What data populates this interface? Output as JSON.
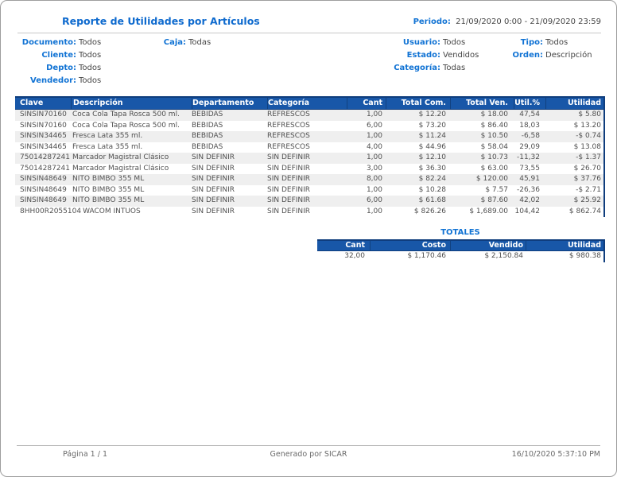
{
  "page": {
    "title": "Reporte de Utilidades por Artículos",
    "periodo": {
      "label": "Periodo:",
      "value": "21/09/2020 0:00  - 21/09/2020 23:59"
    }
  },
  "filters": {
    "documento": {
      "label": "Documento:",
      "value": "Todos"
    },
    "cliente": {
      "label": "Cliente:",
      "value": "Todos"
    },
    "depto": {
      "label": "Depto:",
      "value": "Todos"
    },
    "vendedor": {
      "label": "Vendedor:",
      "value": "Todos"
    },
    "caja": {
      "label": "Caja:",
      "value": "Todas"
    },
    "usuario": {
      "label": "Usuario:",
      "value": "Todos"
    },
    "estado": {
      "label": "Estado:",
      "value": "Vendidos"
    },
    "categoria": {
      "label": "Categoría:",
      "value": "Todas"
    },
    "tipo": {
      "label": "Tipo:",
      "value": "Todos"
    },
    "orden": {
      "label": "Orden:",
      "value": "Descripción"
    }
  },
  "table": {
    "columns": [
      "Clave",
      "Descripción",
      "Departamento",
      "Categoría",
      "Cant",
      "Total Com.",
      "Total Ven.",
      "Util.%",
      "Utilidad"
    ],
    "rows": [
      [
        "SINSIN70160",
        "Coca Cola Tapa Rosca 500 ml.",
        "BEBIDAS",
        "REFRESCOS",
        "1,00",
        "$ 12.20",
        "$ 18.00",
        "47,54",
        "$ 5.80"
      ],
      [
        "SINSIN70160",
        "Coca Cola Tapa Rosca 500 ml.",
        "BEBIDAS",
        "REFRESCOS",
        "6,00",
        "$ 73.20",
        "$ 86.40",
        "18,03",
        "$ 13.20"
      ],
      [
        "SINSIN34465",
        "Fresca Lata 355 ml.",
        "BEBIDAS",
        "REFRESCOS",
        "1,00",
        "$ 11.24",
        "$ 10.50",
        "-6,58",
        "-$ 0.74"
      ],
      [
        "SINSIN34465",
        "Fresca Lata 355 ml.",
        "BEBIDAS",
        "REFRESCOS",
        "4,00",
        "$ 44.96",
        "$ 58.04",
        "29,09",
        "$ 13.08"
      ],
      [
        "75014287241",
        "Marcador Magistral Clásico",
        "SIN DEFINIR",
        "SIN DEFINIR",
        "1,00",
        "$ 12.10",
        "$ 10.73",
        "-11,32",
        "-$ 1.37"
      ],
      [
        "75014287241",
        "Marcador Magistral Clásico",
        "SIN DEFINIR",
        "SIN DEFINIR",
        "3,00",
        "$ 36.30",
        "$ 63.00",
        "73,55",
        "$ 26.70"
      ],
      [
        "SINSIN48649",
        "NITO BIMBO 355 ML",
        "SIN DEFINIR",
        "SIN DEFINIR",
        "8,00",
        "$ 82.24",
        "$ 120.00",
        "45,91",
        "$ 37.76"
      ],
      [
        "SINSIN48649",
        "NITO BIMBO 355 ML",
        "SIN DEFINIR",
        "SIN DEFINIR",
        "1,00",
        "$ 10.28",
        "$ 7.57",
        "-26,36",
        "-$ 2.71"
      ],
      [
        "SINSIN48649",
        "NITO BIMBO 355 ML",
        "SIN DEFINIR",
        "SIN DEFINIR",
        "6,00",
        "$ 61.68",
        "$ 87.60",
        "42,02",
        "$ 25.92"
      ],
      [
        "8HH00R2055104",
        "WACOM INTUOS",
        "SIN DEFINIR",
        "SIN DEFINIR",
        "1,00",
        "$ 826.26",
        "$ 1,689.00",
        "104,42",
        "$ 862.74"
      ]
    ]
  },
  "totals": {
    "title": "TOTALES",
    "columns": [
      "Cant",
      "Costo",
      "Vendido",
      "Utilidad"
    ],
    "values": [
      "32,00",
      "$ 1,170.46",
      "$ 2,150.84",
      "$ 980.38"
    ]
  },
  "footer": {
    "page_label": "Página 1 / 1",
    "generated": "Generado por SICAR",
    "datetime": "16/10/2020 5:37:10 PM"
  },
  "colors": {
    "accent_blue": "#1173d4",
    "title_blue": "#0e6ace",
    "table_header_blue": "#1857a8",
    "table_header_border": "#0f3d7d",
    "row_stripe": "#efefef"
  }
}
